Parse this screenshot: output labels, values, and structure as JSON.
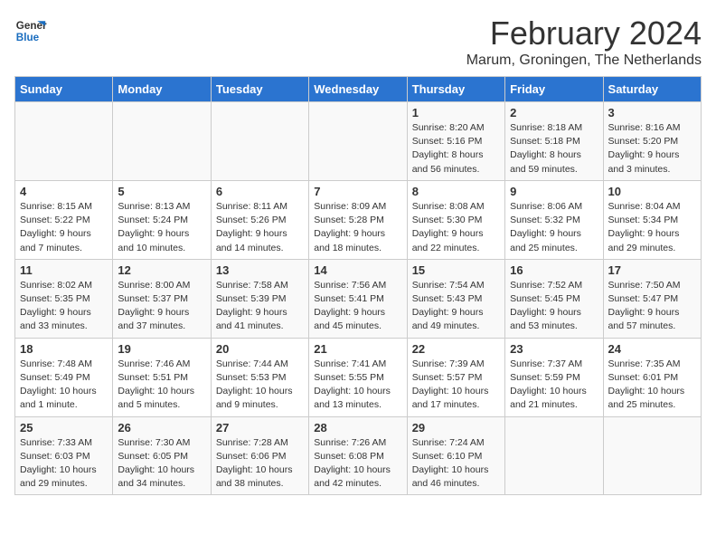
{
  "header": {
    "logo_line1": "General",
    "logo_line2": "Blue",
    "month": "February 2024",
    "location": "Marum, Groningen, The Netherlands"
  },
  "days_of_week": [
    "Sunday",
    "Monday",
    "Tuesday",
    "Wednesday",
    "Thursday",
    "Friday",
    "Saturday"
  ],
  "weeks": [
    [
      {
        "day": "",
        "info": ""
      },
      {
        "day": "",
        "info": ""
      },
      {
        "day": "",
        "info": ""
      },
      {
        "day": "",
        "info": ""
      },
      {
        "day": "1",
        "info": "Sunrise: 8:20 AM\nSunset: 5:16 PM\nDaylight: 8 hours\nand 56 minutes."
      },
      {
        "day": "2",
        "info": "Sunrise: 8:18 AM\nSunset: 5:18 PM\nDaylight: 8 hours\nand 59 minutes."
      },
      {
        "day": "3",
        "info": "Sunrise: 8:16 AM\nSunset: 5:20 PM\nDaylight: 9 hours\nand 3 minutes."
      }
    ],
    [
      {
        "day": "4",
        "info": "Sunrise: 8:15 AM\nSunset: 5:22 PM\nDaylight: 9 hours\nand 7 minutes."
      },
      {
        "day": "5",
        "info": "Sunrise: 8:13 AM\nSunset: 5:24 PM\nDaylight: 9 hours\nand 10 minutes."
      },
      {
        "day": "6",
        "info": "Sunrise: 8:11 AM\nSunset: 5:26 PM\nDaylight: 9 hours\nand 14 minutes."
      },
      {
        "day": "7",
        "info": "Sunrise: 8:09 AM\nSunset: 5:28 PM\nDaylight: 9 hours\nand 18 minutes."
      },
      {
        "day": "8",
        "info": "Sunrise: 8:08 AM\nSunset: 5:30 PM\nDaylight: 9 hours\nand 22 minutes."
      },
      {
        "day": "9",
        "info": "Sunrise: 8:06 AM\nSunset: 5:32 PM\nDaylight: 9 hours\nand 25 minutes."
      },
      {
        "day": "10",
        "info": "Sunrise: 8:04 AM\nSunset: 5:34 PM\nDaylight: 9 hours\nand 29 minutes."
      }
    ],
    [
      {
        "day": "11",
        "info": "Sunrise: 8:02 AM\nSunset: 5:35 PM\nDaylight: 9 hours\nand 33 minutes."
      },
      {
        "day": "12",
        "info": "Sunrise: 8:00 AM\nSunset: 5:37 PM\nDaylight: 9 hours\nand 37 minutes."
      },
      {
        "day": "13",
        "info": "Sunrise: 7:58 AM\nSunset: 5:39 PM\nDaylight: 9 hours\nand 41 minutes."
      },
      {
        "day": "14",
        "info": "Sunrise: 7:56 AM\nSunset: 5:41 PM\nDaylight: 9 hours\nand 45 minutes."
      },
      {
        "day": "15",
        "info": "Sunrise: 7:54 AM\nSunset: 5:43 PM\nDaylight: 9 hours\nand 49 minutes."
      },
      {
        "day": "16",
        "info": "Sunrise: 7:52 AM\nSunset: 5:45 PM\nDaylight: 9 hours\nand 53 minutes."
      },
      {
        "day": "17",
        "info": "Sunrise: 7:50 AM\nSunset: 5:47 PM\nDaylight: 9 hours\nand 57 minutes."
      }
    ],
    [
      {
        "day": "18",
        "info": "Sunrise: 7:48 AM\nSunset: 5:49 PM\nDaylight: 10 hours\nand 1 minute."
      },
      {
        "day": "19",
        "info": "Sunrise: 7:46 AM\nSunset: 5:51 PM\nDaylight: 10 hours\nand 5 minutes."
      },
      {
        "day": "20",
        "info": "Sunrise: 7:44 AM\nSunset: 5:53 PM\nDaylight: 10 hours\nand 9 minutes."
      },
      {
        "day": "21",
        "info": "Sunrise: 7:41 AM\nSunset: 5:55 PM\nDaylight: 10 hours\nand 13 minutes."
      },
      {
        "day": "22",
        "info": "Sunrise: 7:39 AM\nSunset: 5:57 PM\nDaylight: 10 hours\nand 17 minutes."
      },
      {
        "day": "23",
        "info": "Sunrise: 7:37 AM\nSunset: 5:59 PM\nDaylight: 10 hours\nand 21 minutes."
      },
      {
        "day": "24",
        "info": "Sunrise: 7:35 AM\nSunset: 6:01 PM\nDaylight: 10 hours\nand 25 minutes."
      }
    ],
    [
      {
        "day": "25",
        "info": "Sunrise: 7:33 AM\nSunset: 6:03 PM\nDaylight: 10 hours\nand 29 minutes."
      },
      {
        "day": "26",
        "info": "Sunrise: 7:30 AM\nSunset: 6:05 PM\nDaylight: 10 hours\nand 34 minutes."
      },
      {
        "day": "27",
        "info": "Sunrise: 7:28 AM\nSunset: 6:06 PM\nDaylight: 10 hours\nand 38 minutes."
      },
      {
        "day": "28",
        "info": "Sunrise: 7:26 AM\nSunset: 6:08 PM\nDaylight: 10 hours\nand 42 minutes."
      },
      {
        "day": "29",
        "info": "Sunrise: 7:24 AM\nSunset: 6:10 PM\nDaylight: 10 hours\nand 46 minutes."
      },
      {
        "day": "",
        "info": ""
      },
      {
        "day": "",
        "info": ""
      }
    ]
  ]
}
